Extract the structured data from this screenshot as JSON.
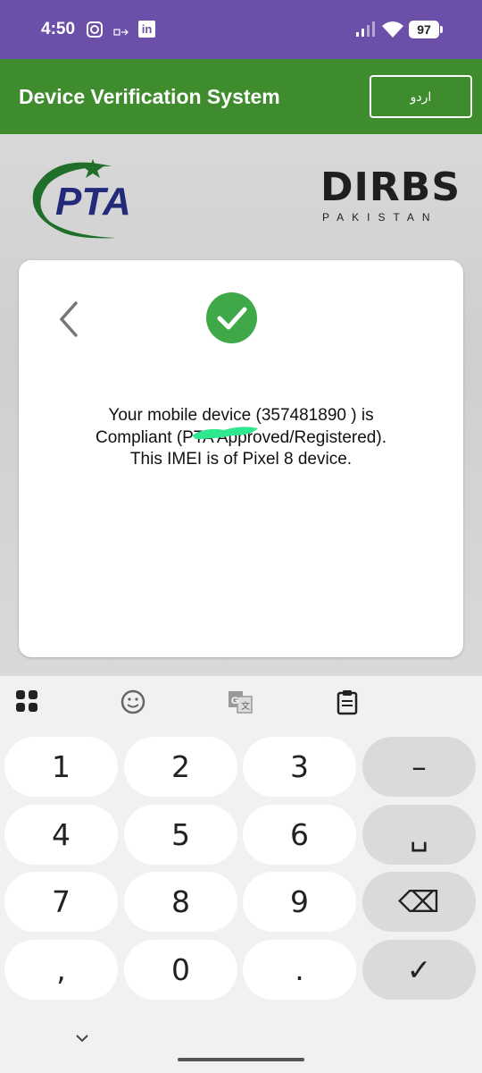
{
  "status_bar": {
    "time": "4:50",
    "battery": "97",
    "icons": [
      "instagram-icon",
      "clipboard-share-icon",
      "linkedin-icon",
      "signal-icon",
      "wifi-icon",
      "battery-icon"
    ]
  },
  "header": {
    "title": "Device Verification System",
    "language_button": "اردو"
  },
  "logos": {
    "left": "PTA",
    "right_main": "DIRBS",
    "right_sub": "PAKISTAN"
  },
  "result": {
    "message_prefix": "Your mobile device (35748189",
    "message_suffix": ") is Compliant (PTA Approved/Registered). This IMEI is of Pixel 8 device.",
    "status_icon": "check-circle-icon",
    "status_color": "#3fa94a"
  },
  "keyboard": {
    "toolbar_icons": [
      "grid-icon",
      "emoji-icon",
      "translate-icon",
      "clipboard-icon"
    ],
    "keys": [
      {
        "label": "1",
        "type": "char"
      },
      {
        "label": "2",
        "type": "char"
      },
      {
        "label": "3",
        "type": "char"
      },
      {
        "label": "–",
        "type": "func"
      },
      {
        "label": "4",
        "type": "char"
      },
      {
        "label": "5",
        "type": "char"
      },
      {
        "label": "6",
        "type": "char"
      },
      {
        "label": "␣",
        "type": "func"
      },
      {
        "label": "7",
        "type": "char"
      },
      {
        "label": "8",
        "type": "char"
      },
      {
        "label": "9",
        "type": "char"
      },
      {
        "label": "⌫",
        "type": "func"
      },
      {
        "label": ",",
        "type": "char"
      },
      {
        "label": "0",
        "type": "char"
      },
      {
        "label": ".",
        "type": "char"
      },
      {
        "label": "✓",
        "type": "func"
      }
    ]
  },
  "colors": {
    "status_bar": "#6b4fa8",
    "header": "#3f8c2f",
    "accent_green": "#3fa94a"
  }
}
